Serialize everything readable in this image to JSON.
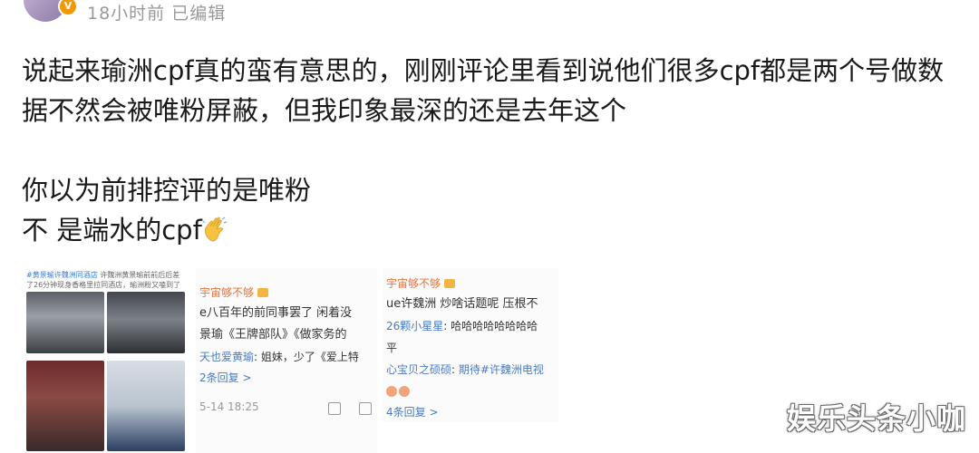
{
  "header": {
    "meta": "18小时前 已编辑",
    "verified_badge": "V"
  },
  "post": {
    "paragraph1": "说起来瑜洲cpf真的蛮有意思的，刚刚评论里看到说他们很多cpf都是两个号做数据不然会被唯粉屏蔽，但我印象最深的还是去年这个",
    "line2": "你以为前排控评的是唯粉",
    "line3": "不 是端水的cpf"
  },
  "shot1": {
    "tag": "#黄景瑜许魏洲同酒店",
    "caption": "许魏洲黄景瑜前前后后差了26分钟现身香格里拉同酒店，瑜洲粉又嗑到了"
  },
  "shot2": {
    "user": "宇宙够不够",
    "line1": "e八百年的前同事罢了 闲着没",
    "line2": "景瑜《王牌部队》《做家务的",
    "reply_user": "天也爱黄瑜",
    "reply_text": "姐妹，少了《爱上特",
    "reply_count": "2条回复 >",
    "timestamp": "5-14 18:25"
  },
  "shot3": {
    "user": "宇宙够不够",
    "line1": "ue许魏洲 炒啥话题呢 压根不",
    "reply1_user": "26颗小星星",
    "reply1_text": "哈哈哈哈哈哈哈哈",
    "reply1_cont": "平",
    "reply2_user": "心宝贝之硕硕",
    "reply2_text": "期待#许魏洲电视",
    "reply_count": "4条回复 >"
  },
  "watermark": "娱乐头条小咖",
  "colors": {
    "link": "#4b7bbf",
    "username": "#e8743b",
    "badge": "#f39800"
  }
}
